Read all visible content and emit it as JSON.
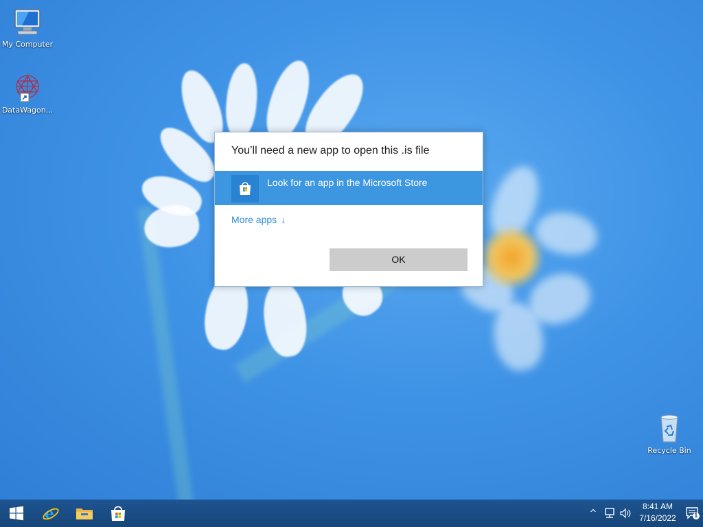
{
  "desktop": {
    "icons": [
      {
        "label": "My Computer",
        "icon": "computer-icon"
      },
      {
        "label": "DataWagon...",
        "icon": "datawagon-shortcut-icon"
      },
      {
        "label": "Recycle Bin",
        "icon": "recycle-bin-icon"
      }
    ]
  },
  "dialog": {
    "title": "You’ll need a new app to open this .is file",
    "store_option_label": "Look for an app in the Microsoft Store",
    "store_icon": "microsoft-store-icon",
    "more_apps_label": "More apps",
    "more_apps_arrow": "↓",
    "ok_label": "OK"
  },
  "taskbar": {
    "buttons": [
      {
        "name": "start",
        "icon": "windows-logo-icon"
      },
      {
        "name": "internet-explorer",
        "icon": "internet-explorer-icon"
      },
      {
        "name": "file-explorer",
        "icon": "folder-icon"
      },
      {
        "name": "microsoft-store",
        "icon": "microsoft-store-icon"
      }
    ],
    "tray": {
      "chevron": "^",
      "time": "8:41 AM",
      "date": "7/16/2022",
      "notification_count": "1"
    }
  },
  "colors": {
    "accent": "#3c96e0",
    "taskbar": "#1b4f8a",
    "link": "#2f8fd8"
  }
}
